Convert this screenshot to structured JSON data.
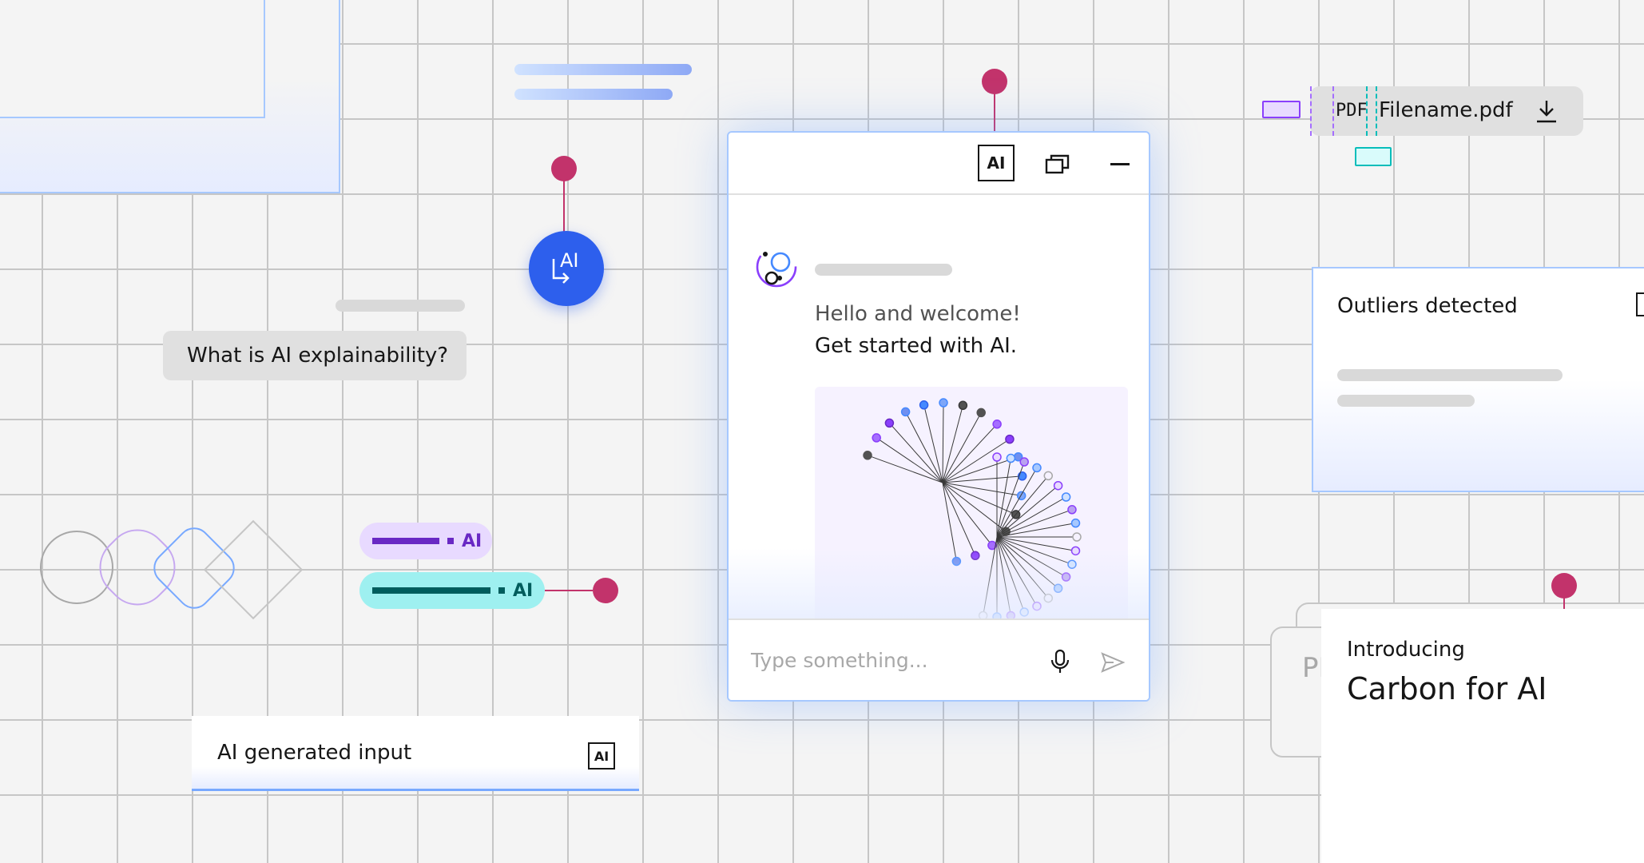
{
  "chat_prompt": "What is AI explainability?",
  "ai_button_label": "AI",
  "tags": {
    "purple_label": "AI",
    "teal_label": "AI"
  },
  "ai_input": {
    "label": "AI generated input",
    "ai_label": "AI"
  },
  "chat_window": {
    "header_ai_label": "AI",
    "greeting_line1": "Hello and welcome!",
    "greeting_line2": "Get started with AI.",
    "input_placeholder": "Type something..."
  },
  "file_chip": {
    "type_label": "PDF",
    "filename": "Filename.pdf"
  },
  "outliers_card": {
    "title": "Outliers detected"
  },
  "intro_card": {
    "eyebrow": "Introducing",
    "title": "Carbon for AI",
    "ghost_text": "PI"
  },
  "colors": {
    "accent_blue": "#2d5fed",
    "magenta": "#c2336b",
    "purple": "#6929c4",
    "teal": "#9ef0f0"
  },
  "icons": [
    "ai-icon",
    "popout-icon",
    "minimize-icon",
    "microphone-icon",
    "send-icon",
    "download-icon",
    "avatar-icon"
  ]
}
